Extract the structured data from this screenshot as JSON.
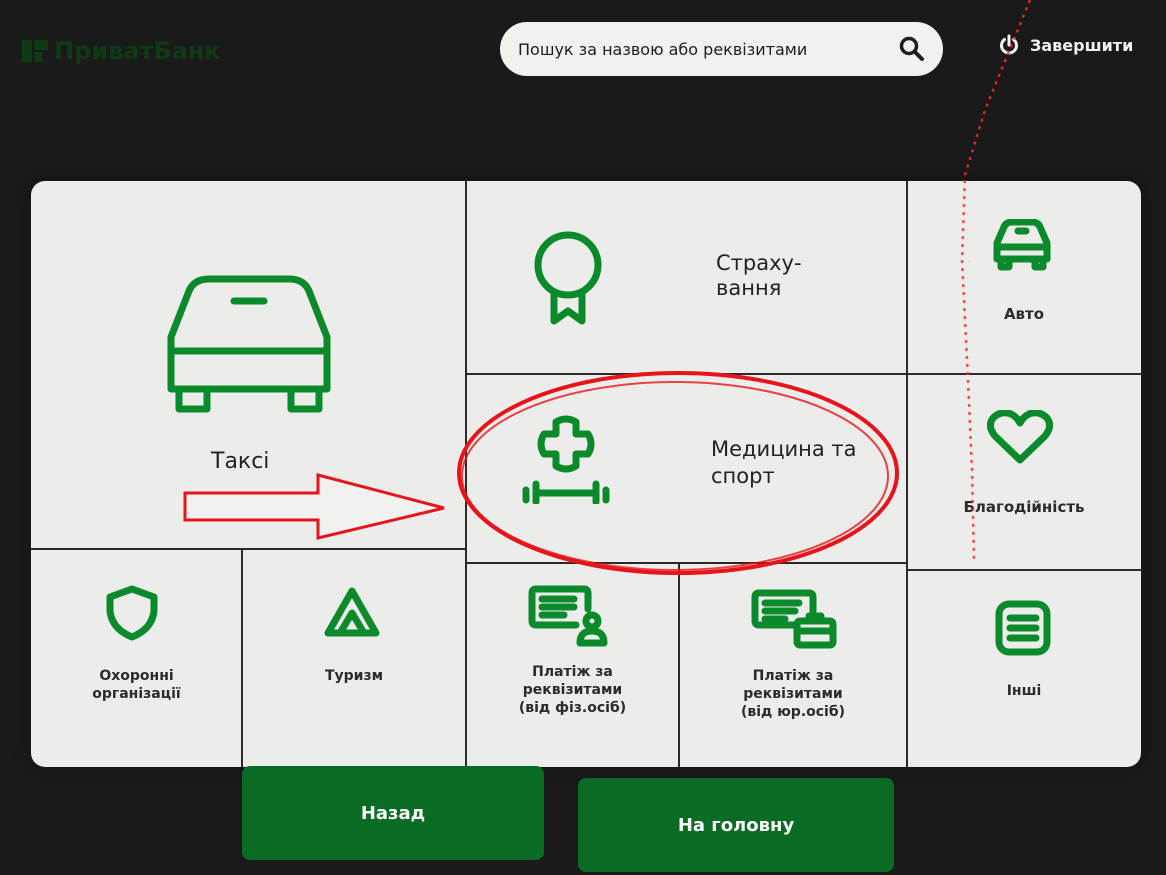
{
  "brand": {
    "name": "ПриватБанк"
  },
  "search": {
    "placeholder": "Пошук за назвою або реквізитами",
    "icon": "search-icon"
  },
  "header": {
    "finish_label": "Завершити",
    "finish_icon": "power-icon"
  },
  "tiles": {
    "taxi": {
      "label": "Таксі",
      "icon": "car-icon"
    },
    "insurance": {
      "label_line1": "Страху-",
      "label_line2": "вання",
      "icon": "award-ribbon-icon"
    },
    "auto": {
      "label": "Авто",
      "icon": "car-icon"
    },
    "medicine": {
      "label_line1": "Медицина та",
      "label_line2": "спорт",
      "icon": "medical-cross-dumbbell-icon"
    },
    "charity": {
      "label": "Благодійність",
      "icon": "heart-icon"
    },
    "security": {
      "label_line1": "Охоронні",
      "label_line2": "організації",
      "icon": "shield-icon"
    },
    "tourism": {
      "label": "Туризм",
      "icon": "tent-icon"
    },
    "pay_person": {
      "label_line1": "Платіж за",
      "label_line2": "реквізитами",
      "label_line3": "(від фіз.осіб)",
      "icon": "document-person-icon"
    },
    "pay_company": {
      "label_line1": "Платіж за",
      "label_line2": "реквізитами",
      "label_line3": "(від юр.осіб)",
      "icon": "document-briefcase-icon"
    },
    "other": {
      "label": "Інші",
      "icon": "list-icon"
    }
  },
  "footer": {
    "back_label": "Назад",
    "home_label": "На головну"
  },
  "colors": {
    "accent": "#0a8a2a",
    "button": "#0a6b24",
    "background": "#1b1a1b",
    "panel": "#ecedea",
    "annotation": "#e8141c"
  }
}
